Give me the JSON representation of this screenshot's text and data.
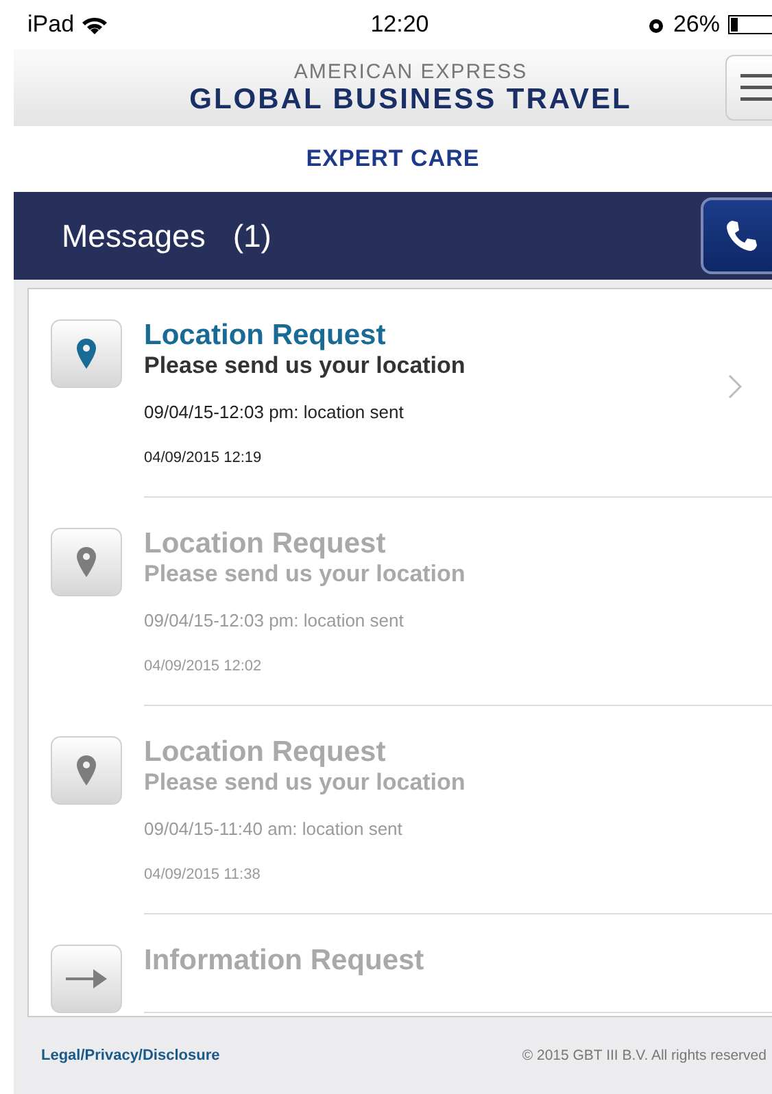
{
  "status_bar": {
    "device": "iPad",
    "time": "12:20",
    "battery": "26%"
  },
  "header": {
    "brand_top": "AMERICAN EXPRESS",
    "brand_bottom": "GLOBAL BUSINESS TRAVEL",
    "subtitle": "EXPERT CARE"
  },
  "messages_bar": {
    "title": "Messages",
    "count": "(1)"
  },
  "messages": [
    {
      "kind": "location",
      "read": false,
      "title": "Location Request",
      "subtitle": "Please send us your location",
      "detail": "09/04/15-12:03 pm: location sent",
      "date": "04/09/2015 12:19"
    },
    {
      "kind": "location",
      "read": true,
      "title": "Location Request",
      "subtitle": "Please send us your location",
      "detail": "09/04/15-12:03 pm: location sent",
      "date": "04/09/2015 12:02"
    },
    {
      "kind": "location",
      "read": true,
      "title": "Location Request",
      "subtitle": "Please send us your location",
      "detail": "09/04/15-11:40 am: location sent",
      "date": "04/09/2015 11:38"
    },
    {
      "kind": "arrow",
      "read": true,
      "title": "Information Request"
    }
  ],
  "footer": {
    "link": "Legal/Privacy/Disclosure",
    "copyright": "© 2015 GBT III B.V. All rights reserved"
  }
}
